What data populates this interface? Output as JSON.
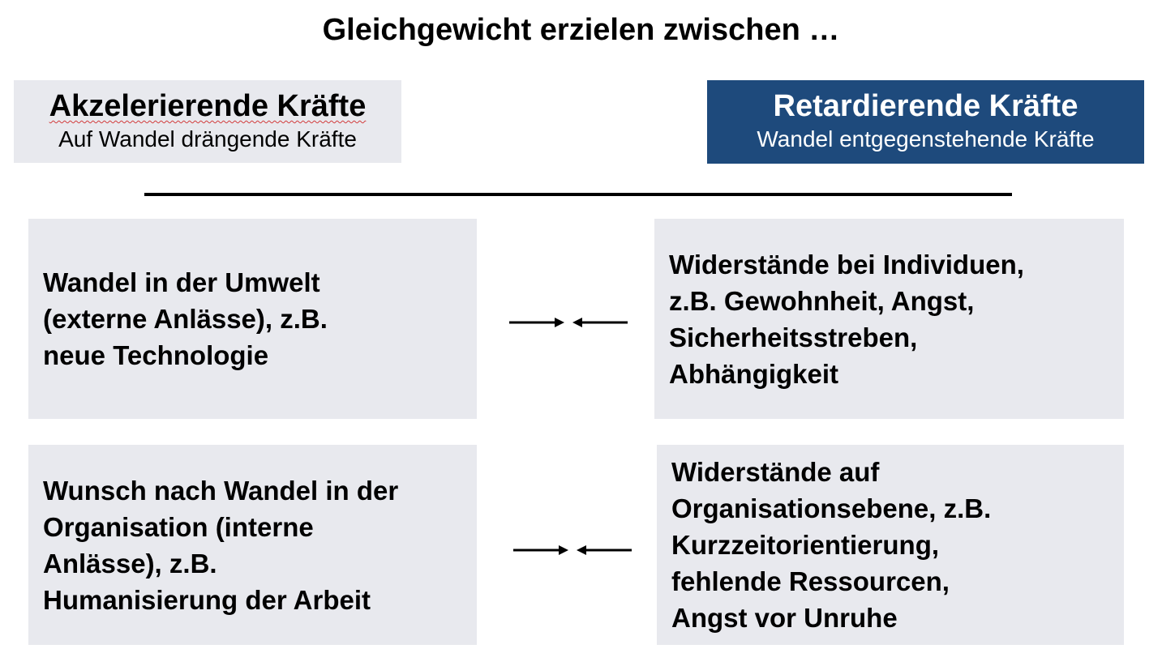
{
  "title": "Gleichgewicht erzielen zwischen …",
  "accelerating": {
    "heading": "Akzelerierende Kräfte",
    "subheading": "Auf Wandel drängende Kräfte"
  },
  "retarding": {
    "heading": "Retardierende Kräfte",
    "subheading": "Wandel entgegenstehende Kräfte"
  },
  "rows": [
    {
      "left": "Wandel in der Umwelt\n(externe Anlässe), z.B.\nneue Technologie",
      "right": "Widerstände bei Individuen,\nz.B. Gewohnheit, Angst,\nSicherheitsstreben,\nAbhängigkeit"
    },
    {
      "left": "Wunsch nach Wandel in der\nOrganisation (interne\nAnlässe), z.B.\nHumanisierung der Arbeit",
      "right": "Widerstände auf\nOrganisationsebene, z.B.\nKurzzeitorientierung,\nfehlende Ressourcen,\nAngst vor  Unruhe"
    }
  ],
  "colors": {
    "box_background": "#e8e9ee",
    "retarding_header_background": "#1e4a7c",
    "text": "#000000"
  }
}
